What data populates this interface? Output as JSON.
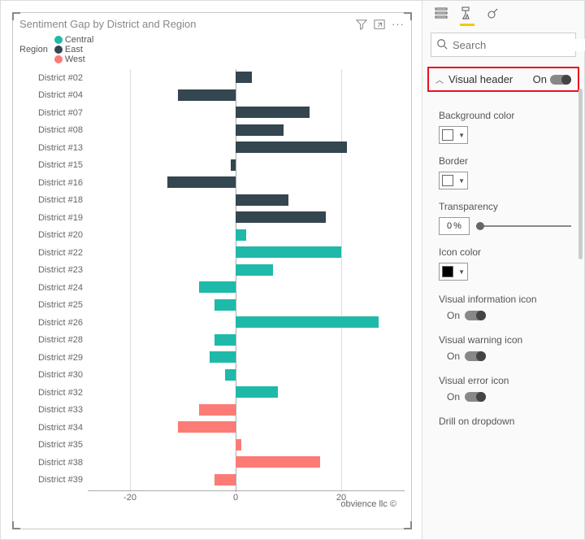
{
  "visual": {
    "title": "Sentiment Gap by District and Region",
    "legend_label": "Region",
    "legend": [
      {
        "name": "Central",
        "color": "#1fb9a9"
      },
      {
        "name": "East",
        "color": "#34464f"
      },
      {
        "name": "West",
        "color": "#fd7b76"
      }
    ],
    "credit": "obvience llc ©"
  },
  "chart_data": {
    "type": "bar",
    "orientation": "horizontal",
    "xlabel": "",
    "ylabel": "",
    "xlim": [
      -28,
      32
    ],
    "xticks": [
      -20,
      0,
      20
    ],
    "series_colors": {
      "Central": "#1fb9a9",
      "East": "#34464f",
      "West": "#fd7b76"
    },
    "rows": [
      {
        "district": "District #02",
        "region": "East",
        "value": 3
      },
      {
        "district": "District #04",
        "region": "East",
        "value": -11
      },
      {
        "district": "District #07",
        "region": "East",
        "value": 14
      },
      {
        "district": "District #08",
        "region": "East",
        "value": 9
      },
      {
        "district": "District #13",
        "region": "East",
        "value": 21
      },
      {
        "district": "District #15",
        "region": "East",
        "value": -1
      },
      {
        "district": "District #16",
        "region": "East",
        "value": -13
      },
      {
        "district": "District #18",
        "region": "East",
        "value": 10
      },
      {
        "district": "District #19",
        "region": "East",
        "value": 17
      },
      {
        "district": "District #20",
        "region": "Central",
        "value": 2
      },
      {
        "district": "District #22",
        "region": "Central",
        "value": 20
      },
      {
        "district": "District #23",
        "region": "Central",
        "value": 7
      },
      {
        "district": "District #24",
        "region": "Central",
        "value": -7
      },
      {
        "district": "District #25",
        "region": "Central",
        "value": -4
      },
      {
        "district": "District #26",
        "region": "Central",
        "value": 27
      },
      {
        "district": "District #28",
        "region": "Central",
        "value": -4
      },
      {
        "district": "District #29",
        "region": "Central",
        "value": -5
      },
      {
        "district": "District #30",
        "region": "Central",
        "value": -2
      },
      {
        "district": "District #32",
        "region": "Central",
        "value": 8
      },
      {
        "district": "District #33",
        "region": "West",
        "value": -7
      },
      {
        "district": "District #34",
        "region": "West",
        "value": -11
      },
      {
        "district": "District #35",
        "region": "West",
        "value": 1
      },
      {
        "district": "District #38",
        "region": "West",
        "value": 16
      },
      {
        "district": "District #39",
        "region": "West",
        "value": -4
      }
    ]
  },
  "panel": {
    "search_placeholder": "Search",
    "section": {
      "label": "Visual header",
      "state": "On"
    },
    "props": {
      "bgcolor_label": "Background color",
      "border_label": "Border",
      "transparency_label": "Transparency",
      "transparency_value": "0",
      "transparency_unit": "%",
      "iconcolor_label": "Icon color",
      "visual_info_label": "Visual information icon",
      "visual_warn_label": "Visual warning icon",
      "visual_err_label": "Visual error icon",
      "drill_label": "Drill on dropdown",
      "on_label": "On"
    }
  }
}
